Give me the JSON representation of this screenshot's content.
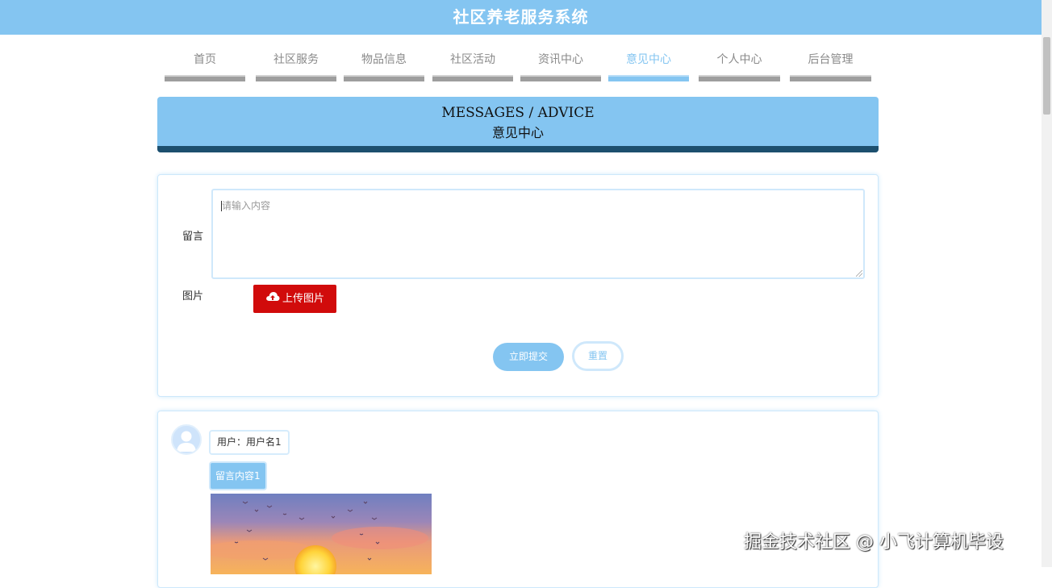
{
  "header": {
    "title": "社区养老服务系统"
  },
  "nav": {
    "items": [
      {
        "label": "首页"
      },
      {
        "label": "社区服务"
      },
      {
        "label": "物品信息"
      },
      {
        "label": "社区活动"
      },
      {
        "label": "资讯中心"
      },
      {
        "label": "意见中心",
        "active": true
      },
      {
        "label": "个人中心"
      },
      {
        "label": "后台管理"
      }
    ]
  },
  "banner": {
    "title_en": "MESSAGES / ADVICE",
    "title_zh": "意见中心"
  },
  "form": {
    "message_label": "留言",
    "message_placeholder": "请输入内容",
    "image_label": "图片",
    "upload_label": "上传图片",
    "submit_label": "立即提交",
    "reset_label": "重置"
  },
  "messages": [
    {
      "user_text": "用户：用户名1",
      "content": "留言内容1"
    }
  ],
  "watermark": "掘金技术社区 @ 小飞计算机毕设",
  "colors": {
    "primary": "#84c5f1",
    "upload": "#d10b0b",
    "banner_bottom": "#1c4f6e"
  }
}
